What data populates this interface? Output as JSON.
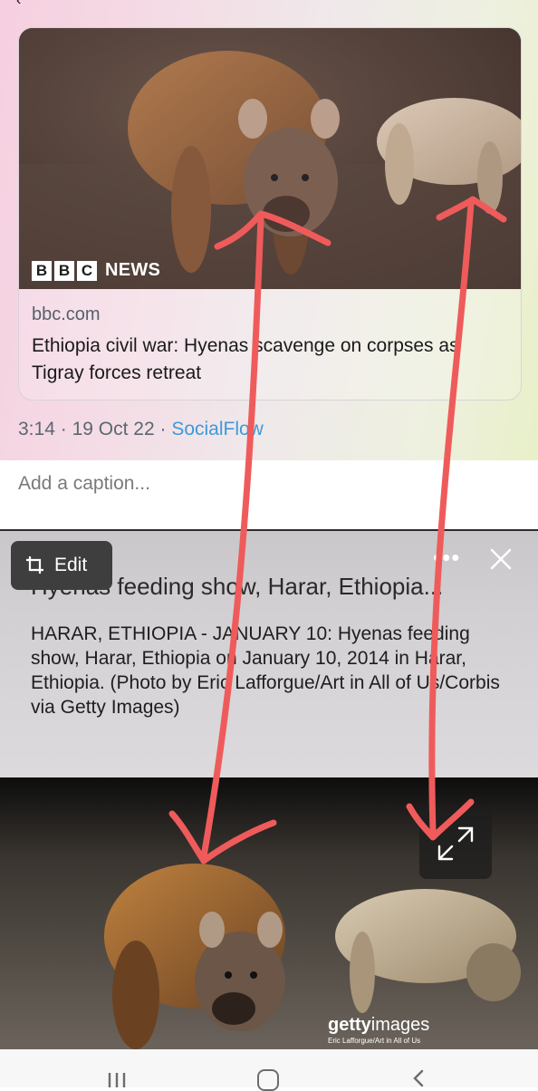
{
  "top_glyph": "‹",
  "tweet": {
    "card": {
      "logo_letters": [
        "B",
        "B",
        "C"
      ],
      "logo_word": "NEWS",
      "domain": "bbc.com",
      "title": "Ethiopia civil war: Hyenas scavenge on corpses as Tigray forces retreat"
    },
    "time": "3:14",
    "date": "19 Oct 22",
    "separator": "·",
    "source": "SocialFlow"
  },
  "caption_placeholder": "Add a caption...",
  "image_panel": {
    "edit_label": "Edit",
    "more_label": "•••",
    "title": "Hyenas feeding show, Harar, Ethiopia...",
    "description": "HARAR, ETHIOPIA - JANUARY 10: Hyenas feeding show, Harar, Ethiopia on January 10, 2014 in Harar, Ethiopia. (Photo by Eric Lafforgue/Art in All of Us/Corbis via Getty Images)"
  },
  "watermark": {
    "brand_bold": "getty",
    "brand_light": "images",
    "credit": "Eric Lafforgue/Art in All of Us"
  },
  "icons": [
    "crop-icon",
    "more-icon",
    "close-icon",
    "expand-icon",
    "recents-icon",
    "home-icon",
    "back-icon"
  ],
  "colors": {
    "link": "#3b9ad8",
    "annotation_arrow": "#ef5b5b",
    "edit_button": "#3e3e3e"
  }
}
